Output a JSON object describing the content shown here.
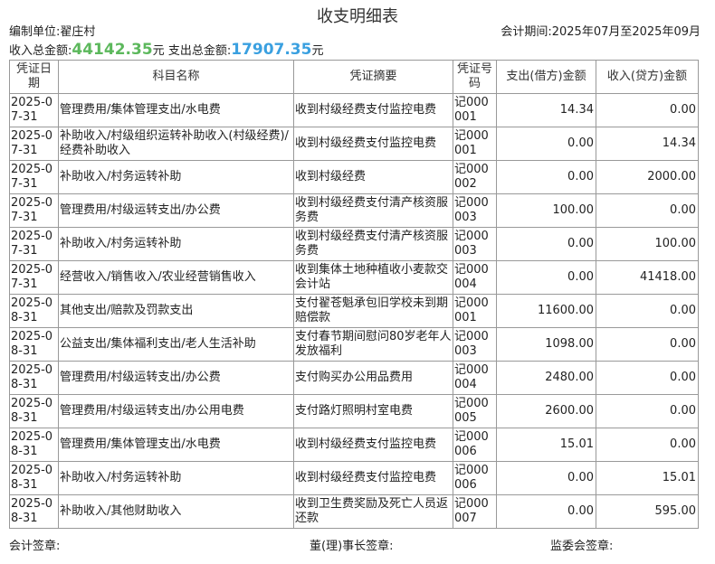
{
  "title": "收支明细表",
  "unit_label": "编制单位:翟庄村",
  "period_label": "会计期间:2025年07月至2025年09月",
  "totals": {
    "income_label": "收入总金额:",
    "income_value": "44142.35",
    "income_suffix": "元",
    "expense_label": "支出总金额:",
    "expense_value": "17907.35",
    "expense_suffix": "元",
    "income_color": "#5cb85c",
    "expense_color": "#3aa0e0"
  },
  "table": {
    "headers": [
      "凭证日期",
      "科目名称",
      "凭证摘要",
      "凭证号码",
      "支出(借方)金额",
      "收入(贷方)金额"
    ],
    "rows": [
      {
        "date": "2025-07-31",
        "subject": "管理费用/集体管理支出/水电费",
        "summary": "收到村级经费支付监控电费",
        "voucher": "记000001",
        "debit": "14.34",
        "credit": "0.00"
      },
      {
        "date": "2025-07-31",
        "subject": "补助收入/村级组织运转补助收入(村级经费)/经费补助收入",
        "summary": "收到村级经费支付监控电费",
        "voucher": "记000001",
        "debit": "0.00",
        "credit": "14.34"
      },
      {
        "date": "2025-07-31",
        "subject": "补助收入/村务运转补助",
        "summary": "收到村级经费",
        "voucher": "记000002",
        "debit": "0.00",
        "credit": "2000.00"
      },
      {
        "date": "2025-07-31",
        "subject": "管理费用/村级运转支出/办公费",
        "summary": "收到村级经费支付清产核资服务费",
        "voucher": "记000003",
        "debit": "100.00",
        "credit": "0.00"
      },
      {
        "date": "2025-07-31",
        "subject": "补助收入/村务运转补助",
        "summary": "收到村级经费支付清产核资服务费",
        "voucher": "记000003",
        "debit": "0.00",
        "credit": "100.00"
      },
      {
        "date": "2025-07-31",
        "subject": "经营收入/销售收入/农业经营销售收入",
        "summary": "收到集体土地种植收小麦款交会计站",
        "voucher": "记000004",
        "debit": "0.00",
        "credit": "41418.00"
      },
      {
        "date": "2025-08-31",
        "subject": "其他支出/赔款及罚款支出",
        "summary": "支付翟苍魁承包旧学校未到期赔偿款",
        "voucher": "记000001",
        "debit": "11600.00",
        "credit": "0.00"
      },
      {
        "date": "2025-08-31",
        "subject": "公益支出/集体福利支出/老人生活补助",
        "summary": "支付春节期间慰问80岁老年人发放福利",
        "voucher": "记000003",
        "debit": "1098.00",
        "credit": "0.00"
      },
      {
        "date": "2025-08-31",
        "subject": "管理费用/村级运转支出/办公费",
        "summary": "支付购买办公用品费用",
        "voucher": "记000004",
        "debit": "2480.00",
        "credit": "0.00"
      },
      {
        "date": "2025-08-31",
        "subject": "管理费用/村级运转支出/办公用电费",
        "summary": "支付路灯照明村室电费",
        "voucher": "记000005",
        "debit": "2600.00",
        "credit": "0.00"
      },
      {
        "date": "2025-08-31",
        "subject": "管理费用/集体管理支出/水电费",
        "summary": "收到村级经费支付监控电费",
        "voucher": "记000006",
        "debit": "15.01",
        "credit": "0.00"
      },
      {
        "date": "2025-08-31",
        "subject": "补助收入/村务运转补助",
        "summary": "收到村级经费支付监控电费",
        "voucher": "记000006",
        "debit": "0.00",
        "credit": "15.01"
      },
      {
        "date": "2025-08-31",
        "subject": "补助收入/其他财助收入",
        "summary": "收到卫生费奖励及死亡人员返还款",
        "voucher": "记000007",
        "debit": "0.00",
        "credit": "595.00"
      }
    ]
  },
  "footer": {
    "accountant": "会计签章:",
    "director": "董(理)事长签章:",
    "supervisor": "监委会签章:"
  }
}
